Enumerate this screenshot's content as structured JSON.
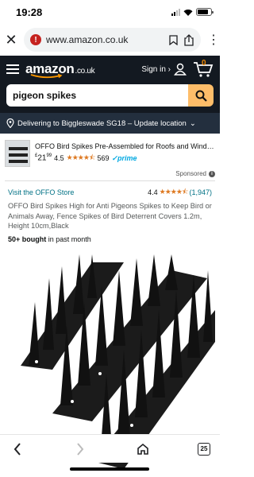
{
  "status_bar": {
    "time": "19:28"
  },
  "browser": {
    "url": "www.amazon.co.uk",
    "warning_glyph": "!"
  },
  "header": {
    "logo": "amazon",
    "tld": ".co.uk",
    "sign_in": "Sign in ›",
    "cart_count": "0"
  },
  "search": {
    "value": "pigeon spikes"
  },
  "delivery": {
    "text": "Delivering to Biggleswade SG18 – Update location",
    "caret": "⌄"
  },
  "sponsored_ad": {
    "title": "OFFO Bird Spikes Pre-Assembled for Roofs and Windows, D...",
    "currency": "£",
    "price_whole": "21",
    "price_fraction": "99",
    "rating": "4.5",
    "stars": "★★★★⯪",
    "review_count": "569",
    "prime": "✓prime",
    "label": "Sponsored",
    "info_glyph": "i"
  },
  "product": {
    "store_link": "Visit the OFFO Store",
    "rating": "4.4",
    "stars": "★★★★⯪",
    "review_count": "(1,947)",
    "title": "OFFO Bird Spikes High for Anti Pigeons Spikes to Keep Bird or Animals Away, Fence Spikes of Bird Deterrent Covers 1.2m, Height 10cm,Black",
    "bought_bold": "50+ bought",
    "bought_rest": " in past month"
  },
  "bottom_bar": {
    "tab_count": "25"
  },
  "icons": {
    "close": "close-icon",
    "warning": "warning-icon",
    "bookmark": "bookmark-icon",
    "share": "share-icon",
    "menu": "hamburger-icon",
    "account": "account-icon",
    "cart": "cart-icon",
    "search": "search-icon",
    "location": "location-pin-icon",
    "back": "back-arrow-icon",
    "forward": "forward-arrow-icon",
    "home": "home-icon",
    "tabs": "tabs-icon"
  },
  "colors": {
    "amazon_header": "#131921",
    "delivery_bar": "#232f3e",
    "search_button": "#febd69",
    "link": "#007185",
    "star": "#de7921",
    "prime": "#00a8e1"
  }
}
